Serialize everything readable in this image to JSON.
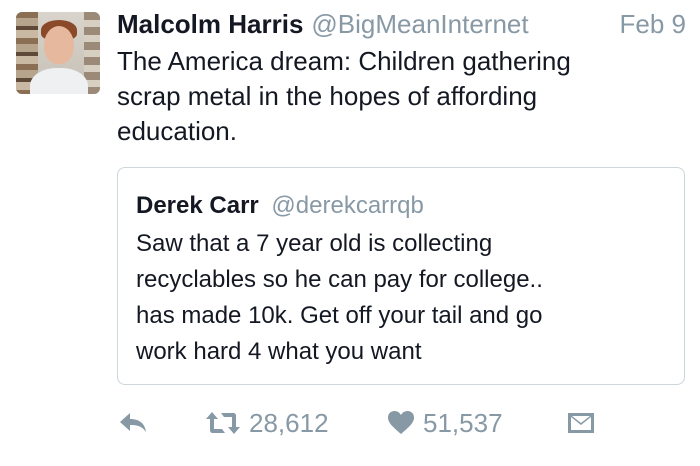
{
  "tweet": {
    "author_name": "Malcolm Harris",
    "author_handle": "@BigMeanInternet",
    "date": "Feb 9",
    "text_lines": [
      "The America dream: Children gathering",
      "scrap metal in the hopes of affording",
      "education."
    ]
  },
  "quoted_tweet": {
    "author_name": "Derek Carr",
    "author_handle": "@derekcarrqb",
    "text_lines": [
      "Saw that a 7 year old is collecting",
      "recyclables so he can pay for college..",
      "has made 10k. Get off your tail and go",
      "work hard 4 what you want"
    ]
  },
  "actions": {
    "reply_icon": "reply-icon",
    "retweet_icon": "retweet-icon",
    "retweet_count": "28,612",
    "like_icon": "heart-icon",
    "like_count": "51,537",
    "dm_icon": "envelope-icon"
  },
  "colors": {
    "text": "#141823",
    "muted": "#8899a6",
    "border": "#ccd6dd"
  }
}
